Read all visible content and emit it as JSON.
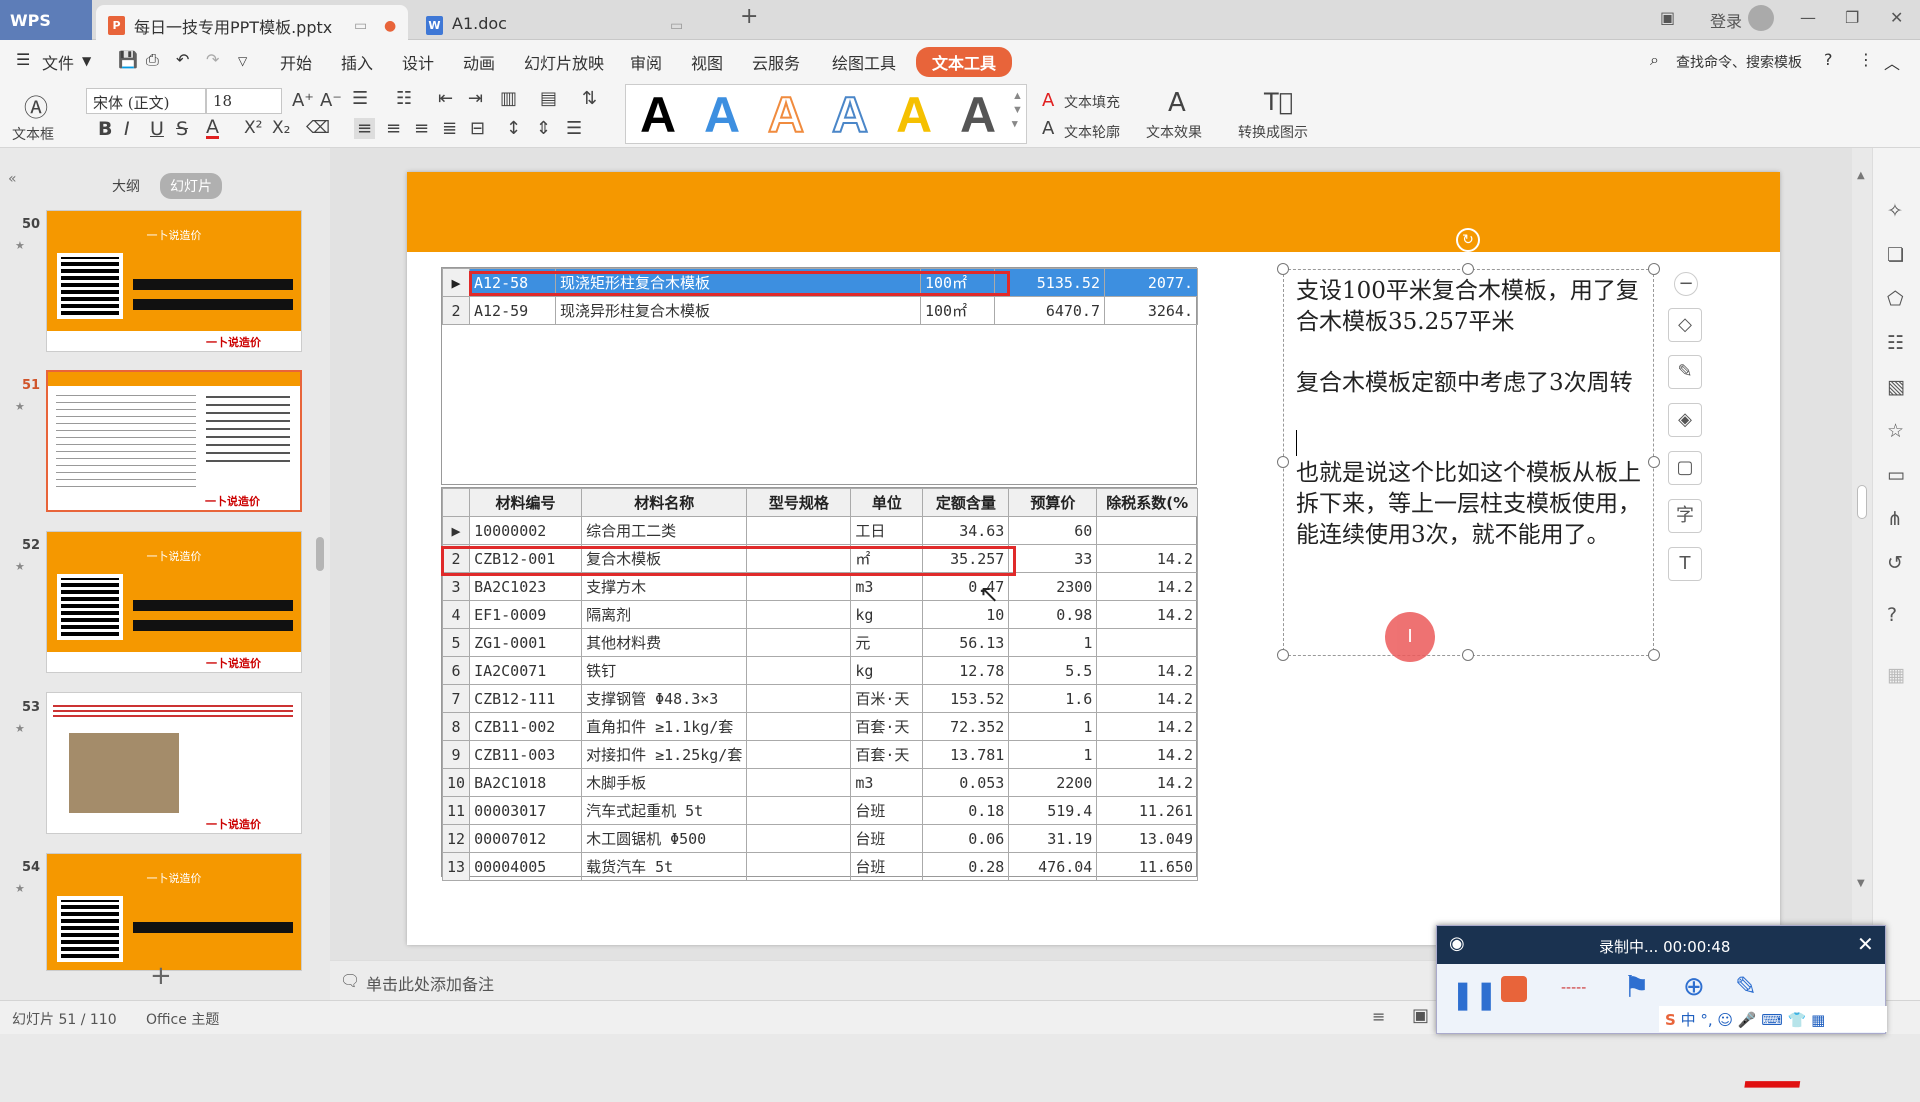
{
  "titlebar": {
    "app": "WPS",
    "tabs": [
      {
        "label": "每日一技专用PPT模板.pptx",
        "icon": "P"
      },
      {
        "label": "A1.doc",
        "icon": "W"
      }
    ],
    "login": "登录"
  },
  "menubar": {
    "file": "文件",
    "items": [
      "开始",
      "插入",
      "设计",
      "动画",
      "幻灯片放映",
      "审阅",
      "视图",
      "云服务",
      "绘图工具"
    ],
    "active": "文本工具",
    "search": "查找命令、搜索模板"
  },
  "ribbon": {
    "textbox": "文本框",
    "font": "宋体 (正文)",
    "size": "18",
    "fill": "文本填充",
    "outline": "文本轮廓",
    "effect": "文本效果",
    "convert": "转换成图示",
    "sample_letter": "A"
  },
  "sidebar": {
    "outline_tab": "大纲",
    "slides_tab": "幻灯片",
    "slides": [
      {
        "num": "50"
      },
      {
        "num": "51"
      },
      {
        "num": "52"
      },
      {
        "num": "53"
      },
      {
        "num": "54"
      }
    ],
    "thumb_header": "一卜说造价",
    "thumb_footer": "一卜说造价"
  },
  "table1": {
    "rows": [
      [
        "A12-58",
        "现浇矩形柱复合木模板",
        "100㎡",
        "5135.52",
        "2077."
      ],
      [
        "A12-59",
        "现浇异形柱复合木模板",
        "100㎡",
        "6470.7",
        "3264."
      ]
    ],
    "idx": [
      "",
      "2"
    ]
  },
  "table2": {
    "headers": [
      "材料编号",
      "材料名称",
      "型号规格",
      "单位",
      "定额含量",
      "预算价",
      "除税系数(%"
    ],
    "rows": [
      [
        "",
        "10000002",
        "综合用工二类",
        "",
        "工日",
        "34.63",
        "60",
        ""
      ],
      [
        "2",
        "CZB12-001",
        "复合木模板",
        "",
        "㎡",
        "35.257",
        "33",
        "14.2"
      ],
      [
        "3",
        "BA2C1023",
        "支撑方木",
        "",
        "m3",
        "0.47",
        "2300",
        "14.2"
      ],
      [
        "4",
        "EF1-0009",
        "隔离剂",
        "",
        "kg",
        "10",
        "0.98",
        "14.2"
      ],
      [
        "5",
        "ZG1-0001",
        "其他材料费",
        "",
        "元",
        "56.13",
        "1",
        ""
      ],
      [
        "6",
        "IA2C0071",
        "铁钉",
        "",
        "kg",
        "12.78",
        "5.5",
        "14.2"
      ],
      [
        "7",
        "CZB12-111",
        "支撑钢管 Φ48.3×3",
        "",
        "百米·天",
        "153.52",
        "1.6",
        "14.2"
      ],
      [
        "8",
        "CZB11-002",
        "直角扣件 ≥1.1kg/套",
        "",
        "百套·天",
        "72.352",
        "1",
        "14.2"
      ],
      [
        "9",
        "CZB11-003",
        "对接扣件 ≥1.25kg/套",
        "",
        "百套·天",
        "13.781",
        "1",
        "14.2"
      ],
      [
        "10",
        "BA2C1018",
        "木脚手板",
        "",
        "m3",
        "0.053",
        "2200",
        "14.2"
      ],
      [
        "11",
        "00003017",
        "汽车式起重机 5t",
        "",
        "台班",
        "0.18",
        "519.4",
        "11.261"
      ],
      [
        "12",
        "00007012",
        "木工圆锯机 Φ500",
        "",
        "台班",
        "0.06",
        "31.19",
        "13.049"
      ],
      [
        "13",
        "00004005",
        "载货汽车 5t",
        "",
        "台班",
        "0.28",
        "476.04",
        "11.650"
      ]
    ]
  },
  "textbox": {
    "p1": "支设100平米复合木模板，用了复合木模板35.257平米",
    "p2": "复合木模板定额中考虑了3次周转",
    "p3": "也就是说这个比如这个模板从板上拆下来，等上一层柱支模板使用，能连续使用3次，就不能用了。"
  },
  "signature": "一卜说造价",
  "notes": {
    "placeholder": "单击此处添加备注"
  },
  "status": {
    "slide": "幻灯片 51 / 110",
    "theme": "Office 主题"
  },
  "recorder": {
    "status": "录制中... 00:00:48"
  },
  "colors": {
    "accent": "#e8643a",
    "banner": "#f59800",
    "selection": "#3d8fe0"
  }
}
